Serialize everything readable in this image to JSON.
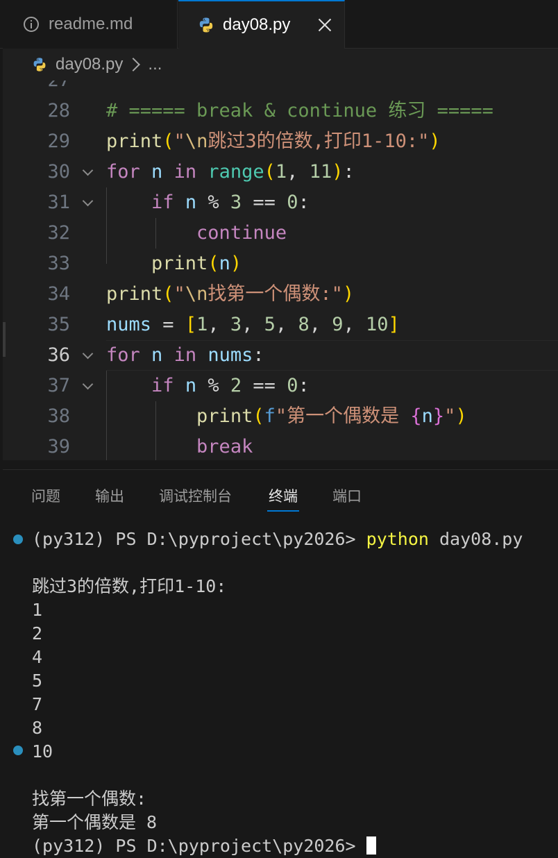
{
  "tabs": [
    {
      "label": "readme.md",
      "icon": "info-icon",
      "active": false
    },
    {
      "label": "day08.py",
      "icon": "python-icon",
      "active": true
    }
  ],
  "breadcrumb": {
    "file": "day08.py",
    "more": "..."
  },
  "editor": {
    "partial_line_number": "27",
    "lines": [
      {
        "num": "28"
      },
      {
        "num": "29"
      },
      {
        "num": "30"
      },
      {
        "num": "31"
      },
      {
        "num": "32"
      },
      {
        "num": "33"
      },
      {
        "num": "34"
      },
      {
        "num": "35"
      },
      {
        "num": "36"
      },
      {
        "num": "37"
      },
      {
        "num": "38"
      },
      {
        "num": "39"
      }
    ],
    "current_line": "36"
  },
  "panel": {
    "tabs": [
      "问题",
      "输出",
      "调试控制台",
      "终端",
      "端口"
    ],
    "active_tab": "终端"
  },
  "terminal": {
    "prompt": "(py312) PS D:\\pyproject\\py2026> ",
    "command_program": "python",
    "command_args": " day08.py",
    "output": [
      "跳过3的倍数,打印1-10:",
      "1",
      "2",
      "4",
      "5",
      "7",
      "8",
      "10",
      "",
      "找第一个偶数:",
      "第一个偶数是 8"
    ],
    "partial_prompt": "(py312) PS D:\\pyproject\\py2026> "
  },
  "colors": {
    "accent": "#0078d4",
    "editor_bg": "#1f1f1f",
    "panel_bg": "#181818",
    "terminal_dot": "#2a8fbd"
  }
}
